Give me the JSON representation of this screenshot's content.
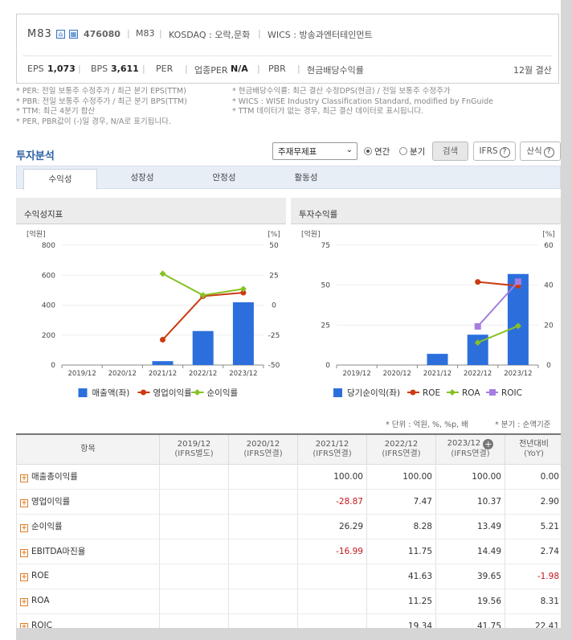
{
  "header": {
    "name": "M83",
    "code": "476080",
    "subname": "M83",
    "market": "KOSDAQ : 오락,문화",
    "wics": "WICS : 방송과엔터테인먼트",
    "eps_label": "EPS",
    "eps_value": "1,073",
    "bps_label": "BPS",
    "bps_value": "3,611",
    "per_label": "PER",
    "ind_per_label": "업종PER",
    "ind_per_value": "N/A",
    "pbr_label": "PBR",
    "dividend_label": "현금배당수익률",
    "settle": "12월 결산"
  },
  "notes": {
    "left": [
      "* PER: 전일 보통주 수정주가 / 최근 분기 EPS(TTM)",
      "* PBR: 전일 보통주 수정주가 / 최근 분기 BPS(TTM)",
      "* TTM: 최근 4분기 합산",
      "* PER, PBR값이 (-)일 경우, N/A로 표기됩니다."
    ],
    "right": [
      "* 현금배당수익률: 최근 결산 수정DPS(현금) / 전일 보통주 수정주가",
      "* WICS : WISE Industry Classification Standard, modified by FnGuide",
      "* TTM 데이터가 없는 경우, 최근 결산 데이터로 표시됩니다."
    ]
  },
  "analysis": {
    "title": "투자분석",
    "select_value": "주재무제표",
    "radio_annual": "연간",
    "radio_quarter": "분기",
    "search_btn": "검색",
    "ifrs_btn": "IFRS",
    "formula_btn": "산식"
  },
  "tabs": [
    "수익성",
    "성장성",
    "안정성",
    "활동성"
  ],
  "left_panel": {
    "title": "수익성지표",
    "unit_left": "[억원]",
    "unit_right": "[%]"
  },
  "right_panel": {
    "title": "투자수익률",
    "unit_left": "[억원]",
    "unit_right": "[%]"
  },
  "chart_data": [
    {
      "type": "bar",
      "categories": [
        "2019/12",
        "2020/12",
        "2021/12",
        "2022/12",
        "2023/12"
      ],
      "ylim": [
        0,
        800
      ],
      "y2lim": [
        -50,
        50
      ],
      "yticks": [
        "800",
        "600",
        "400",
        "200",
        "0"
      ],
      "y2ticks": [
        "50",
        "25",
        "0",
        "-25",
        "-50"
      ],
      "series": [
        {
          "name": "매출액(좌)",
          "type": "bar",
          "axis": "left",
          "color": "#2c6fdc",
          "values": [
            null,
            null,
            26,
            227,
            419
          ]
        },
        {
          "name": "영업이익률",
          "type": "line",
          "axis": "right",
          "color": "#cc3a12",
          "values": [
            null,
            null,
            -28.87,
            7.47,
            10.37
          ]
        },
        {
          "name": "순이익률",
          "type": "line",
          "axis": "right",
          "color": "#86c225",
          "values": [
            null,
            null,
            26.29,
            8.28,
            13.49
          ]
        }
      ],
      "legend_position": "bottom"
    },
    {
      "type": "bar",
      "categories": [
        "2019/12",
        "2020/12",
        "2021/12",
        "2022/12",
        "2023/12"
      ],
      "ylim": [
        0,
        75
      ],
      "y2lim": [
        0,
        60
      ],
      "yticks": [
        "75",
        "50",
        "25",
        "0"
      ],
      "y2ticks": [
        "60",
        "40",
        "20",
        "0"
      ],
      "series": [
        {
          "name": "당기순이익(좌)",
          "type": "bar",
          "axis": "left",
          "color": "#2c6fdc",
          "values": [
            null,
            null,
            7,
            19,
            57
          ]
        },
        {
          "name": "ROE",
          "type": "line",
          "axis": "right",
          "color": "#cc3a12",
          "values": [
            null,
            null,
            null,
            41.63,
            39.65
          ]
        },
        {
          "name": "ROA",
          "type": "line",
          "axis": "right",
          "color": "#86c225",
          "values": [
            null,
            null,
            null,
            11.25,
            19.56
          ]
        },
        {
          "name": "ROIC",
          "type": "line",
          "axis": "right",
          "color": "#a57ee0",
          "values": [
            null,
            null,
            null,
            19.34,
            41.75
          ]
        }
      ],
      "legend_position": "bottom"
    }
  ],
  "units_text": "* 단위 : 억원, %, %p, 배",
  "quarter_text": "* 분기 : 순액기준",
  "table": {
    "header_item": "항목",
    "columns": [
      {
        "year": "2019/12",
        "basis": "(IFRS별도)"
      },
      {
        "year": "2020/12",
        "basis": "(IFRS연결)"
      },
      {
        "year": "2021/12",
        "basis": "(IFRS연결)"
      },
      {
        "year": "2022/12",
        "basis": "(IFRS연결)"
      },
      {
        "year": "2023/12",
        "basis": "(IFRS연결)"
      },
      {
        "year": "전년대비",
        "basis": "(YoY)"
      }
    ],
    "rows": [
      {
        "label": "매출총이익률",
        "values": [
          "",
          "",
          "100.00",
          "100.00",
          "100.00",
          "0.00"
        ]
      },
      {
        "label": "영업이익률",
        "values": [
          "",
          "",
          "-28.87",
          "7.47",
          "10.37",
          "2.90"
        ]
      },
      {
        "label": "순이익률",
        "values": [
          "",
          "",
          "26.29",
          "8.28",
          "13.49",
          "5.21"
        ]
      },
      {
        "label": "EBITDA마진율",
        "values": [
          "",
          "",
          "-16.99",
          "11.75",
          "14.49",
          "2.74"
        ]
      },
      {
        "label": "ROE",
        "values": [
          "",
          "",
          "",
          "41.63",
          "39.65",
          "-1.98"
        ]
      },
      {
        "label": "ROA",
        "values": [
          "",
          "",
          "",
          "11.25",
          "19.56",
          "8.31"
        ]
      },
      {
        "label": "ROIC",
        "values": [
          "",
          "",
          "",
          "19.34",
          "41.75",
          "22.41"
        ]
      }
    ]
  }
}
